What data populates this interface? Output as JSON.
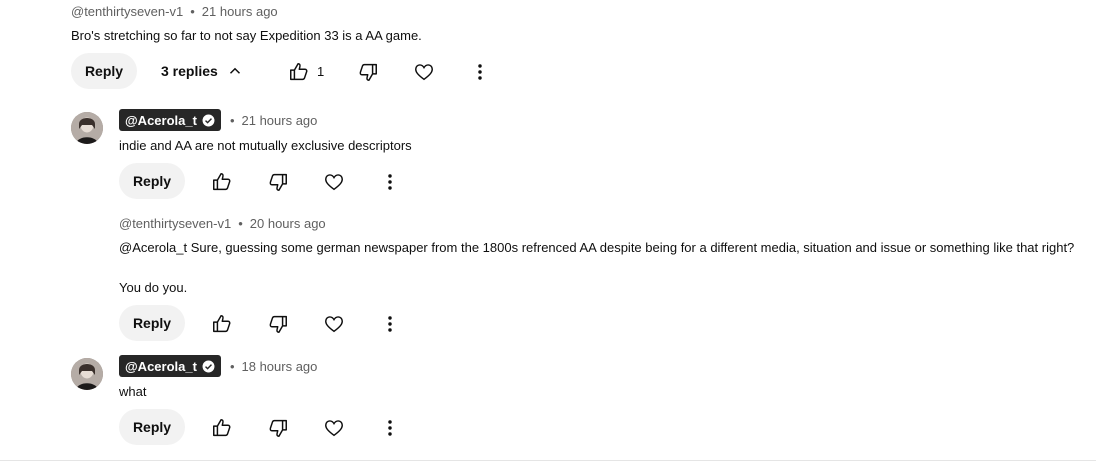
{
  "comments": [
    {
      "author": "@tenthirtyseven-v1",
      "time": "21 hours ago",
      "text": "Bro's stretching so far to not say Expedition 33 is a AA game.",
      "reply_label": "Reply",
      "replies_toggle": "3 replies",
      "like_count": "1"
    }
  ],
  "replies": [
    {
      "author": "@Acerola_t",
      "time": "21 hours ago",
      "text": "indie and AA are not mutually exclusive descriptors",
      "reply_label": "Reply"
    },
    {
      "author": "@tenthirtyseven-v1",
      "time": "20 hours ago",
      "text_line1": "@Acerola_t Sure, guessing some german newspaper from the 1800s refrenced AA despite being for a different media, situation and issue or something like that right?",
      "text_line2": "You do you.",
      "reply_label": "Reply"
    },
    {
      "author": "@Acerola_t",
      "time": "18 hours ago",
      "text": "what",
      "reply_label": "Reply"
    }
  ],
  "separator": "•",
  "icons": {
    "like": "thumbs-up-icon",
    "dislike": "thumbs-down-icon",
    "heart": "heart-icon",
    "more": "more-vert-icon",
    "chevron": "chevron-up-icon",
    "verified": "verified-check-icon"
  }
}
